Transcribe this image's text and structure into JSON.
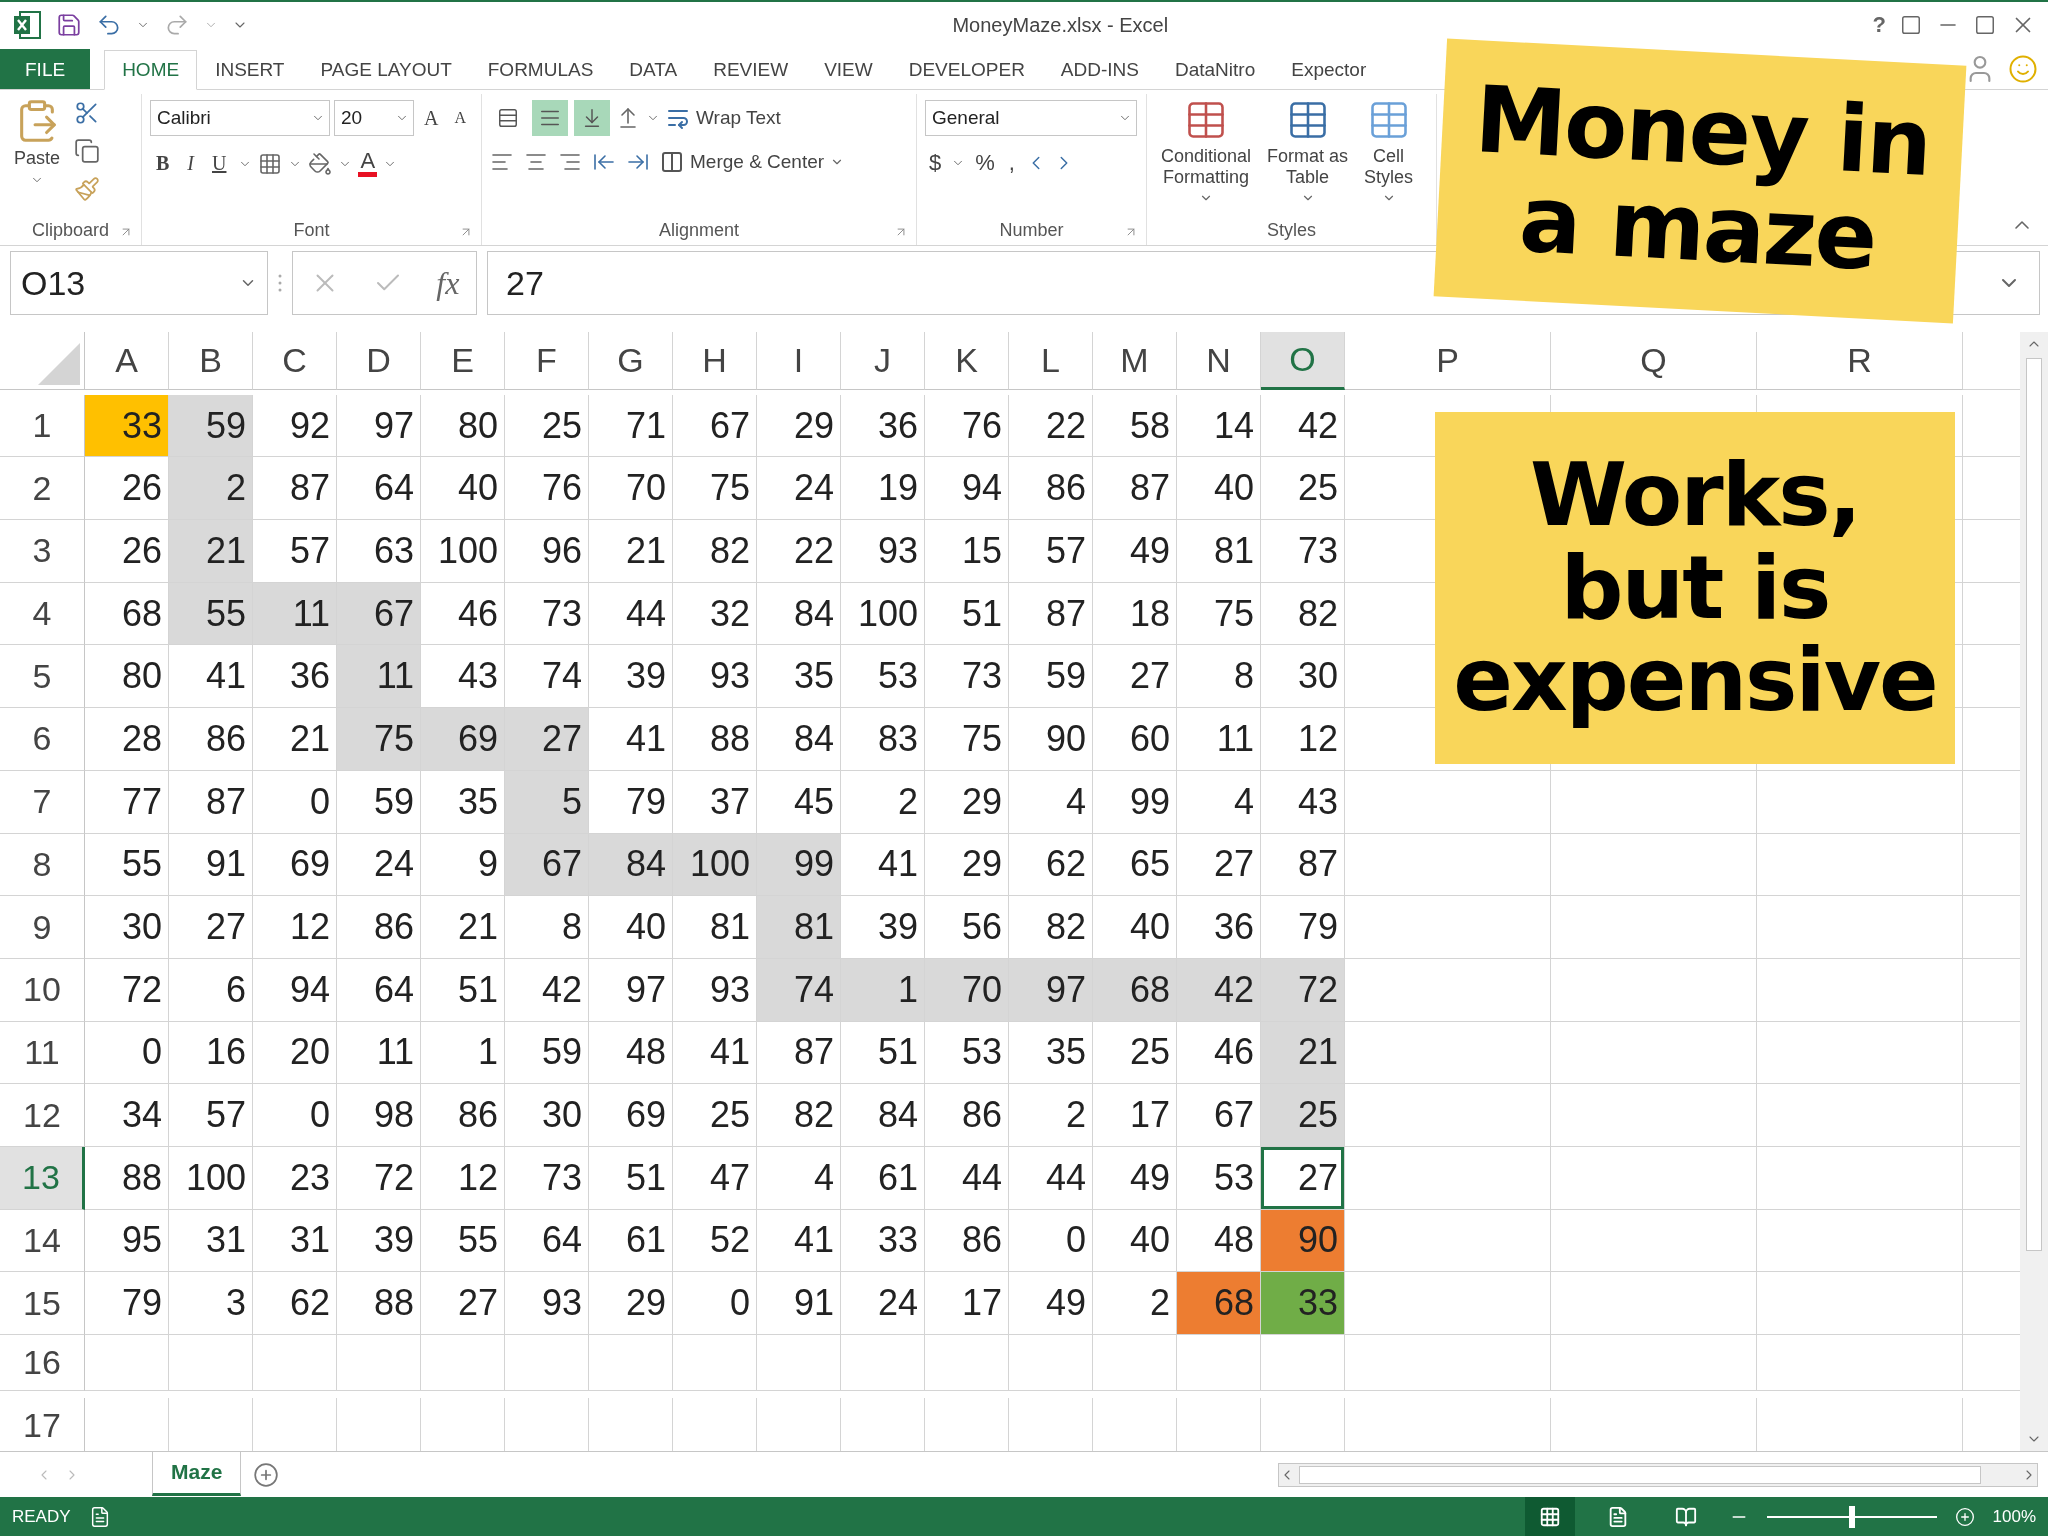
{
  "window": {
    "title": "MoneyMaze.xlsx - Excel",
    "help": "?"
  },
  "ribbon_tabs": [
    {
      "label": "FILE",
      "kind": "file",
      "selected": false
    },
    {
      "label": "HOME",
      "kind": "tab",
      "selected": true
    },
    {
      "label": "INSERT",
      "kind": "tab",
      "selected": false
    },
    {
      "label": "PAGE LAYOUT",
      "kind": "tab",
      "selected": false
    },
    {
      "label": "FORMULAS",
      "kind": "tab",
      "selected": false
    },
    {
      "label": "DATA",
      "kind": "tab",
      "selected": false
    },
    {
      "label": "REVIEW",
      "kind": "tab",
      "selected": false
    },
    {
      "label": "VIEW",
      "kind": "tab",
      "selected": false
    },
    {
      "label": "DEVELOPER",
      "kind": "tab",
      "selected": false
    },
    {
      "label": "ADD-INS",
      "kind": "tab",
      "selected": false
    },
    {
      "label": "DataNitro",
      "kind": "addin",
      "selected": false
    },
    {
      "label": "Expector",
      "kind": "addin",
      "selected": false
    }
  ],
  "ribbon": {
    "clipboard": {
      "label": "Clipboard",
      "paste": "Paste"
    },
    "font": {
      "label": "Font",
      "name": "Calibri",
      "size": "20",
      "grow": "A",
      "shrink": "A",
      "styles": [
        "B",
        "I",
        "U"
      ],
      "color_letter": "A"
    },
    "alignment": {
      "label": "Alignment",
      "vertical_buttons": [
        {
          "selected": false
        },
        {
          "selected": true
        },
        {
          "selected": true
        }
      ],
      "wrap": "Wrap Text",
      "merge": "Merge & Center"
    },
    "number": {
      "label": "Number",
      "format": "General",
      "symbols": [
        "$",
        "%",
        ","
      ]
    },
    "styles": {
      "label": "Styles",
      "buttons": [
        [
          "Conditional",
          "Formatting"
        ],
        [
          "Format as",
          "Table"
        ],
        [
          "Cell",
          "Styles"
        ]
      ]
    }
  },
  "formula_bar": {
    "name_box": "O13",
    "fx": "fx",
    "value": "27"
  },
  "columns": [
    {
      "label": "A",
      "selected": false
    },
    {
      "label": "B",
      "selected": false
    },
    {
      "label": "C",
      "selected": false
    },
    {
      "label": "D",
      "selected": false
    },
    {
      "label": "E",
      "selected": false
    },
    {
      "label": "F",
      "selected": false
    },
    {
      "label": "G",
      "selected": false
    },
    {
      "label": "H",
      "selected": false
    },
    {
      "label": "I",
      "selected": false
    },
    {
      "label": "J",
      "selected": false
    },
    {
      "label": "K",
      "selected": false
    },
    {
      "label": "L",
      "selected": false
    },
    {
      "label": "M",
      "selected": false
    },
    {
      "label": "N",
      "selected": false
    },
    {
      "label": "O",
      "selected": true
    },
    {
      "label": "P",
      "selected": false
    },
    {
      "label": "Q",
      "selected": false
    },
    {
      "label": "R",
      "selected": false
    }
  ],
  "rows": [
    {
      "label": "1",
      "selected": false,
      "cells": [
        {
          "v": "33",
          "color": "#ffc000"
        },
        {
          "v": "59",
          "color": "#d9d9d9"
        },
        {
          "v": "92"
        },
        {
          "v": "97"
        },
        {
          "v": "80"
        },
        {
          "v": "25"
        },
        {
          "v": "71"
        },
        {
          "v": "67"
        },
        {
          "v": "29"
        },
        {
          "v": "36"
        },
        {
          "v": "76"
        },
        {
          "v": "22"
        },
        {
          "v": "58"
        },
        {
          "v": "14"
        },
        {
          "v": "42"
        }
      ]
    },
    {
      "label": "2",
      "selected": false,
      "cells": [
        {
          "v": "26"
        },
        {
          "v": "2",
          "color": "#d9d9d9"
        },
        {
          "v": "87"
        },
        {
          "v": "64"
        },
        {
          "v": "40"
        },
        {
          "v": "76"
        },
        {
          "v": "70"
        },
        {
          "v": "75"
        },
        {
          "v": "24"
        },
        {
          "v": "19"
        },
        {
          "v": "94"
        },
        {
          "v": "86"
        },
        {
          "v": "87"
        },
        {
          "v": "40"
        },
        {
          "v": "25"
        }
      ]
    },
    {
      "label": "3",
      "selected": false,
      "cells": [
        {
          "v": "26"
        },
        {
          "v": "21",
          "color": "#d9d9d9"
        },
        {
          "v": "57"
        },
        {
          "v": "63"
        },
        {
          "v": "100"
        },
        {
          "v": "96"
        },
        {
          "v": "21"
        },
        {
          "v": "82"
        },
        {
          "v": "22"
        },
        {
          "v": "93"
        },
        {
          "v": "15"
        },
        {
          "v": "57"
        },
        {
          "v": "49"
        },
        {
          "v": "81"
        },
        {
          "v": "73"
        }
      ]
    },
    {
      "label": "4",
      "selected": false,
      "cells": [
        {
          "v": "68"
        },
        {
          "v": "55",
          "color": "#d9d9d9"
        },
        {
          "v": "11",
          "color": "#d9d9d9"
        },
        {
          "v": "67",
          "color": "#d9d9d9"
        },
        {
          "v": "46"
        },
        {
          "v": "73"
        },
        {
          "v": "44"
        },
        {
          "v": "32"
        },
        {
          "v": "84"
        },
        {
          "v": "100"
        },
        {
          "v": "51"
        },
        {
          "v": "87"
        },
        {
          "v": "18"
        },
        {
          "v": "75"
        },
        {
          "v": "82"
        }
      ]
    },
    {
      "label": "5",
      "selected": false,
      "cells": [
        {
          "v": "80"
        },
        {
          "v": "41"
        },
        {
          "v": "36"
        },
        {
          "v": "11",
          "color": "#d9d9d9"
        },
        {
          "v": "43"
        },
        {
          "v": "74"
        },
        {
          "v": "39"
        },
        {
          "v": "93"
        },
        {
          "v": "35"
        },
        {
          "v": "53"
        },
        {
          "v": "73"
        },
        {
          "v": "59"
        },
        {
          "v": "27"
        },
        {
          "v": "8"
        },
        {
          "v": "30"
        }
      ]
    },
    {
      "label": "6",
      "selected": false,
      "cells": [
        {
          "v": "28"
        },
        {
          "v": "86"
        },
        {
          "v": "21"
        },
        {
          "v": "75",
          "color": "#d9d9d9"
        },
        {
          "v": "69",
          "color": "#d9d9d9"
        },
        {
          "v": "27",
          "color": "#d9d9d9"
        },
        {
          "v": "41"
        },
        {
          "v": "88"
        },
        {
          "v": "84"
        },
        {
          "v": "83"
        },
        {
          "v": "75"
        },
        {
          "v": "90"
        },
        {
          "v": "60"
        },
        {
          "v": "11"
        },
        {
          "v": "12"
        }
      ]
    },
    {
      "label": "7",
      "selected": false,
      "cells": [
        {
          "v": "77"
        },
        {
          "v": "87"
        },
        {
          "v": "0"
        },
        {
          "v": "59"
        },
        {
          "v": "35"
        },
        {
          "v": "5",
          "color": "#d9d9d9"
        },
        {
          "v": "79"
        },
        {
          "v": "37"
        },
        {
          "v": "45"
        },
        {
          "v": "2"
        },
        {
          "v": "29"
        },
        {
          "v": "4"
        },
        {
          "v": "99"
        },
        {
          "v": "4"
        },
        {
          "v": "43"
        }
      ]
    },
    {
      "label": "8",
      "selected": false,
      "cells": [
        {
          "v": "55"
        },
        {
          "v": "91"
        },
        {
          "v": "69"
        },
        {
          "v": "24"
        },
        {
          "v": "9"
        },
        {
          "v": "67",
          "color": "#d9d9d9"
        },
        {
          "v": "84",
          "color": "#d9d9d9"
        },
        {
          "v": "100",
          "color": "#d9d9d9"
        },
        {
          "v": "99",
          "color": "#d9d9d9"
        },
        {
          "v": "41"
        },
        {
          "v": "29"
        },
        {
          "v": "62"
        },
        {
          "v": "65"
        },
        {
          "v": "27"
        },
        {
          "v": "87"
        }
      ]
    },
    {
      "label": "9",
      "selected": false,
      "cells": [
        {
          "v": "30"
        },
        {
          "v": "27"
        },
        {
          "v": "12"
        },
        {
          "v": "86"
        },
        {
          "v": "21"
        },
        {
          "v": "8"
        },
        {
          "v": "40"
        },
        {
          "v": "81"
        },
        {
          "v": "81",
          "color": "#d9d9d9"
        },
        {
          "v": "39"
        },
        {
          "v": "56"
        },
        {
          "v": "82"
        },
        {
          "v": "40"
        },
        {
          "v": "36"
        },
        {
          "v": "79"
        }
      ]
    },
    {
      "label": "10",
      "selected": false,
      "cells": [
        {
          "v": "72"
        },
        {
          "v": "6"
        },
        {
          "v": "94"
        },
        {
          "v": "64"
        },
        {
          "v": "51"
        },
        {
          "v": "42"
        },
        {
          "v": "97"
        },
        {
          "v": "93"
        },
        {
          "v": "74",
          "color": "#d9d9d9"
        },
        {
          "v": "1",
          "color": "#d9d9d9"
        },
        {
          "v": "70",
          "color": "#d9d9d9"
        },
        {
          "v": "97",
          "color": "#d9d9d9"
        },
        {
          "v": "68",
          "color": "#d9d9d9"
        },
        {
          "v": "42",
          "color": "#d9d9d9"
        },
        {
          "v": "72",
          "color": "#d9d9d9"
        }
      ]
    },
    {
      "label": "11",
      "selected": false,
      "cells": [
        {
          "v": "0"
        },
        {
          "v": "16"
        },
        {
          "v": "20"
        },
        {
          "v": "11"
        },
        {
          "v": "1"
        },
        {
          "v": "59"
        },
        {
          "v": "48"
        },
        {
          "v": "41"
        },
        {
          "v": "87"
        },
        {
          "v": "51"
        },
        {
          "v": "53"
        },
        {
          "v": "35"
        },
        {
          "v": "25"
        },
        {
          "v": "46"
        },
        {
          "v": "21",
          "color": "#d9d9d9"
        }
      ]
    },
    {
      "label": "12",
      "selected": false,
      "cells": [
        {
          "v": "34"
        },
        {
          "v": "57"
        },
        {
          "v": "0"
        },
        {
          "v": "98"
        },
        {
          "v": "86"
        },
        {
          "v": "30"
        },
        {
          "v": "69"
        },
        {
          "v": "25"
        },
        {
          "v": "82"
        },
        {
          "v": "84"
        },
        {
          "v": "86"
        },
        {
          "v": "2"
        },
        {
          "v": "17"
        },
        {
          "v": "67"
        },
        {
          "v": "25",
          "color": "#d9d9d9"
        }
      ]
    },
    {
      "label": "13",
      "selected": true,
      "cells": [
        {
          "v": "88"
        },
        {
          "v": "100"
        },
        {
          "v": "23"
        },
        {
          "v": "72"
        },
        {
          "v": "12"
        },
        {
          "v": "73"
        },
        {
          "v": "51"
        },
        {
          "v": "47"
        },
        {
          "v": "4"
        },
        {
          "v": "61"
        },
        {
          "v": "44"
        },
        {
          "v": "44"
        },
        {
          "v": "49"
        },
        {
          "v": "53"
        },
        {
          "v": "27"
        }
      ]
    },
    {
      "label": "14",
      "selected": false,
      "cells": [
        {
          "v": "95"
        },
        {
          "v": "31"
        },
        {
          "v": "31"
        },
        {
          "v": "39"
        },
        {
          "v": "55"
        },
        {
          "v": "64"
        },
        {
          "v": "61"
        },
        {
          "v": "52"
        },
        {
          "v": "41"
        },
        {
          "v": "33"
        },
        {
          "v": "86"
        },
        {
          "v": "0"
        },
        {
          "v": "40"
        },
        {
          "v": "48"
        },
        {
          "v": "90",
          "color": "#ed7d31"
        }
      ]
    },
    {
      "label": "15",
      "selected": false,
      "cells": [
        {
          "v": "79"
        },
        {
          "v": "3"
        },
        {
          "v": "62"
        },
        {
          "v": "88"
        },
        {
          "v": "27"
        },
        {
          "v": "93"
        },
        {
          "v": "29"
        },
        {
          "v": "0"
        },
        {
          "v": "91"
        },
        {
          "v": "24"
        },
        {
          "v": "17"
        },
        {
          "v": "49"
        },
        {
          "v": "2"
        },
        {
          "v": "68",
          "color": "#ed7d31"
        },
        {
          "v": "33",
          "color": "#70ad47"
        }
      ]
    },
    {
      "label": "16",
      "selected": false,
      "cells": []
    },
    {
      "label": "17",
      "selected": false,
      "cells": []
    }
  ],
  "sheet_tabs": [
    {
      "label": "Maze",
      "selected": true
    }
  ],
  "status_bar": {
    "state": "READY",
    "zoom": "100%",
    "zoom_slider": {
      "level": 0.5
    }
  },
  "notes": [
    {
      "text": "Money in\na maze"
    },
    {
      "text": "Works,\nbut is\nexpensive"
    }
  ]
}
